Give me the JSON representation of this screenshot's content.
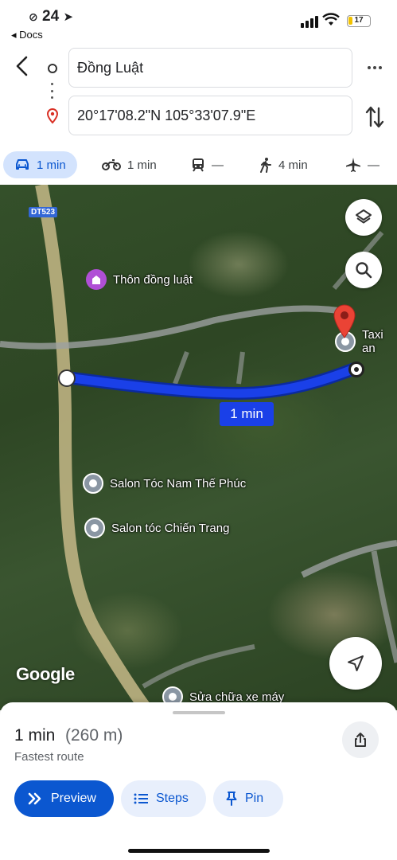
{
  "status_bar": {
    "time": "24",
    "back_app": "◂ Docs",
    "battery": "17"
  },
  "directions": {
    "origin_value": "Đồng Luật",
    "destination_value": "20°17'08.2\"N 105°33'07.9\"E"
  },
  "modes": [
    {
      "icon": "car-icon",
      "label": "1 min",
      "active": true
    },
    {
      "icon": "motorbike-icon",
      "label": "1 min"
    },
    {
      "icon": "transit-icon",
      "label": "—"
    },
    {
      "icon": "walk-icon",
      "label": "4 min"
    },
    {
      "icon": "flight-icon",
      "label": "—"
    }
  ],
  "map": {
    "road_badge": "DT523",
    "route_label": "1 min",
    "google_logo": "Google",
    "pois": {
      "village": "Thôn đồng luật",
      "salon1": "Salon Tóc Nam Thế Phúc",
      "salon2": "Salon tóc Chiến Trang",
      "repair": "Sửa chữa xe máy",
      "taxi": "Taxi an"
    }
  },
  "sheet": {
    "duration": "1 min",
    "distance": "(260 m)",
    "route_desc": "Fastest route",
    "preview_label": "Preview",
    "steps_label": "Steps",
    "pin_label": "Pin"
  },
  "colors": {
    "route": "#1a40e8",
    "accent": "#0b57d0",
    "active_tab_bg": "#d3e3fd",
    "dest_pin": "#ea4335"
  }
}
